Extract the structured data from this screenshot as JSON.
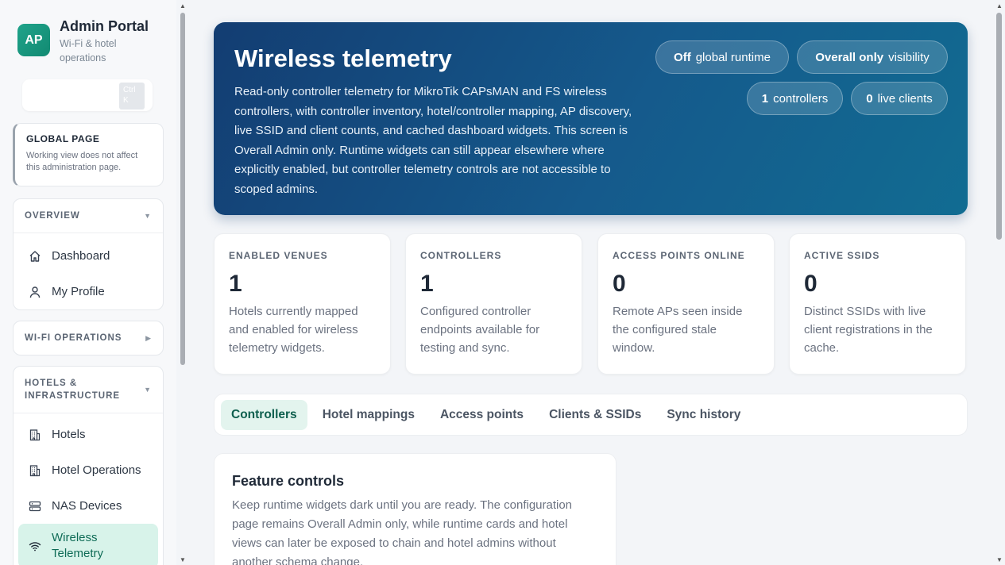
{
  "brand": {
    "logo": "AP",
    "title": "Admin Portal",
    "subtitle": "Wi-Fi & hotel operations"
  },
  "search": {
    "shortcut": "Ctrl K"
  },
  "global_page": {
    "heading": "GLOBAL PAGE",
    "description": "Working view does not affect this administration page."
  },
  "sections": {
    "overview": {
      "label": "OVERVIEW",
      "items": [
        {
          "label": "Dashboard",
          "icon": "home-icon"
        },
        {
          "label": "My Profile",
          "icon": "user-icon"
        }
      ]
    },
    "wifi_ops": {
      "label": "WI-FI OPERATIONS"
    },
    "hotels": {
      "label": "HOTELS & INFRASTRUCTURE",
      "items": [
        {
          "label": "Hotels",
          "icon": "building-icon"
        },
        {
          "label": "Hotel Operations",
          "icon": "building-icon"
        },
        {
          "label": "NAS Devices",
          "icon": "server-icon"
        },
        {
          "label": "Wireless Telemetry",
          "icon": "wifi-icon"
        }
      ]
    }
  },
  "hero": {
    "title": "Wireless telemetry",
    "description": "Read-only controller telemetry for MikroTik CAPsMAN and FS wireless controllers, with controller inventory, hotel/controller mapping, AP discovery, live SSID and client counts, and cached dashboard widgets. This screen is Overall Admin only. Runtime widgets can still appear elsewhere where explicitly enabled, but controller telemetry controls are not accessible to scoped admins.",
    "pills": {
      "runtime": {
        "value": "Off",
        "label": "global runtime"
      },
      "visibility": {
        "value": "Overall only",
        "label": "visibility"
      },
      "controllers": {
        "value": "1",
        "label": "controllers"
      },
      "clients": {
        "value": "0",
        "label": "live clients"
      }
    }
  },
  "stats": [
    {
      "label": "ENABLED VENUES",
      "value": "1",
      "description": "Hotels currently mapped and enabled for wireless telemetry widgets."
    },
    {
      "label": "CONTROLLERS",
      "value": "1",
      "description": "Configured controller endpoints available for testing and sync."
    },
    {
      "label": "ACCESS POINTS ONLINE",
      "value": "0",
      "description": "Remote APs seen inside the configured stale window."
    },
    {
      "label": "ACTIVE SSIDS",
      "value": "0",
      "description": "Distinct SSIDs with live client registrations in the cache."
    }
  ],
  "tabs": [
    "Controllers",
    "Hotel mappings",
    "Access points",
    "Clients & SSIDs",
    "Sync history"
  ],
  "feature": {
    "title": "Feature controls",
    "description": "Keep runtime widgets dark until you are ready. The configuration page remains Overall Admin only, while runtime cards and hotel views can later be exposed to chain and hotel admins without another schema change."
  }
}
